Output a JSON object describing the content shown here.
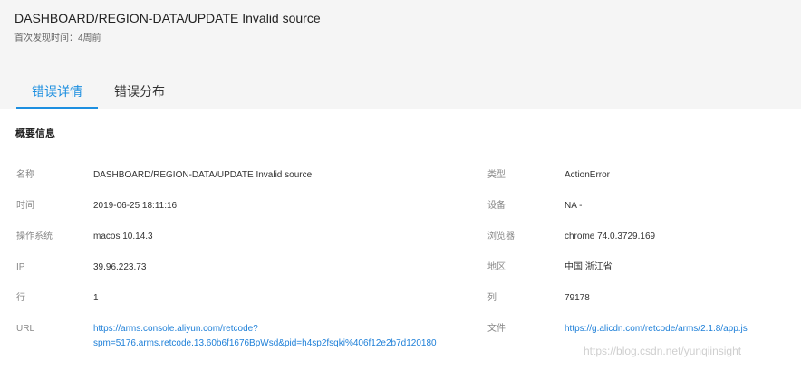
{
  "header": {
    "title": "DASHBOARD/REGION-DATA/UPDATE Invalid source",
    "first_seen_label": "首次发现时间：",
    "first_seen_value": "4周前"
  },
  "tabs": [
    {
      "label": "错误详情",
      "active": true
    },
    {
      "label": "错误分布",
      "active": false
    }
  ],
  "section": {
    "title": "概要信息"
  },
  "fields": {
    "name": {
      "label": "名称",
      "value": "DASHBOARD/REGION-DATA/UPDATE Invalid source"
    },
    "type": {
      "label": "类型",
      "value": "ActionError"
    },
    "time": {
      "label": "时间",
      "value": "2019-06-25 18:11:16"
    },
    "device": {
      "label": "设备",
      "value": "NA -"
    },
    "os": {
      "label": "操作系统",
      "value": "macos 10.14.3"
    },
    "browser": {
      "label": "浏览器",
      "value": "chrome 74.0.3729.169"
    },
    "ip": {
      "label": "IP",
      "value": "39.96.223.73"
    },
    "region": {
      "label": "地区",
      "value": "中国 浙江省"
    },
    "line": {
      "label": "行",
      "value": "1"
    },
    "column": {
      "label": "列",
      "value": "79178"
    },
    "url": {
      "label": "URL",
      "value_line1": "https://arms.console.aliyun.com/retcode?",
      "value_line2": "spm=5176.arms.retcode.13.60b6f1676BpWsd&pid=h4sp2fsqki%406f12e2b7d120180"
    },
    "file": {
      "label": "文件",
      "value": "https://g.alicdn.com/retcode/arms/2.1.8/app.js"
    }
  },
  "watermark": "https://blog.csdn.net/yunqiinsight",
  "colors": {
    "accent": "#1d8fe0",
    "link": "#1d7fd8",
    "header_bg": "#f5f5f5"
  }
}
